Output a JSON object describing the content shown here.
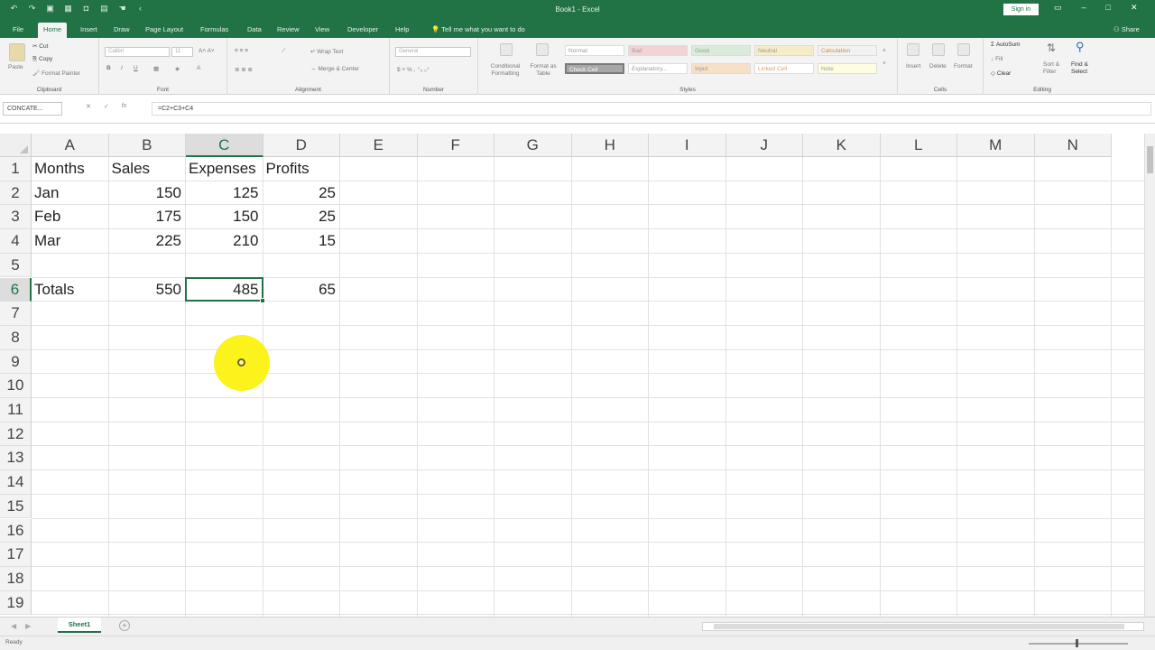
{
  "window": {
    "title": "Book1 - Excel",
    "signin_label": "Sign in"
  },
  "tabs": [
    "File",
    "Home",
    "Insert",
    "Draw",
    "Page Layout",
    "Formulas",
    "Data",
    "Review",
    "View",
    "Developer",
    "Help"
  ],
  "active_tab": "Home",
  "tell_me": "Tell me what you want to do",
  "share_label": "Share",
  "ribbon": {
    "clipboard": {
      "label": "Clipboard",
      "paste": "Paste",
      "cut": "Cut",
      "copy": "Copy",
      "format_painter": "Format Painter"
    },
    "font": {
      "label": "Font",
      "font_name": "Calibri",
      "font_size": "11"
    },
    "alignment": {
      "label": "Alignment",
      "wrap_text": "Wrap Text",
      "merge_center": "Merge & Center"
    },
    "number": {
      "label": "Number",
      "format": "General"
    },
    "styles": {
      "label": "Styles",
      "conditional_formatting": "Conditional Formatting",
      "format_as_table": "Format as Table",
      "cell_styles": [
        "Normal",
        "Bad",
        "Good",
        "Neutral",
        "Calculation",
        "Check Cell",
        "Explanatory...",
        "Input",
        "Linked Cell",
        "Note"
      ]
    },
    "cells": {
      "label": "Cells",
      "insert": "Insert",
      "delete": "Delete",
      "format": "Format"
    },
    "editing": {
      "label": "Editing",
      "autosum": "AutoSum",
      "fill": "Fill",
      "clear": "Clear",
      "sort_filter": "Sort & Filter",
      "find_select": "Find & Select"
    }
  },
  "formula_bar": {
    "name_box": "CONCATE...",
    "formula": "=C2+C3+C4"
  },
  "columns": [
    "A",
    "B",
    "C",
    "D",
    "E",
    "F",
    "G",
    "H",
    "I",
    "J",
    "K",
    "L",
    "M",
    "N"
  ],
  "selected_column": "C",
  "rows": [
    "1",
    "2",
    "3",
    "4",
    "5",
    "6",
    "7",
    "8",
    "9",
    "10",
    "11",
    "12",
    "13",
    "14",
    "15",
    "16",
    "17",
    "18",
    "19"
  ],
  "selected_row": "6",
  "cells": {
    "A1": "Months",
    "B1": "Sales",
    "C1": "Expenses",
    "D1": "Profits",
    "A2": "Jan",
    "B2": "150",
    "C2": "125",
    "D2": "25",
    "A3": "Feb",
    "B3": "175",
    "C3": "150",
    "D3": "25",
    "A4": "Mar",
    "B4": "225",
    "C4": "210",
    "D4": "15",
    "A6": "Totals",
    "B6": "550",
    "C6": "485",
    "D6": "65"
  },
  "active_cell": "C6",
  "sheet_tabs": [
    "Sheet1"
  ],
  "status": {
    "mode": "Ready"
  },
  "colors": {
    "accent": "#217346",
    "cursor_highlight": "#fbf20a"
  }
}
